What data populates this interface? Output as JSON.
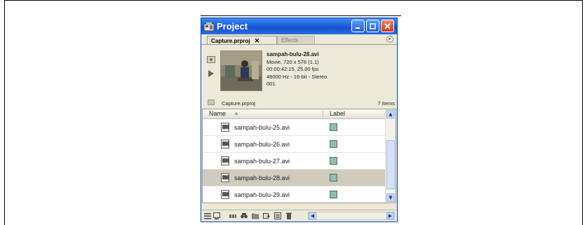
{
  "window": {
    "title": "Project",
    "icon": "premiere-app-icon",
    "controls": [
      "minimize-icon",
      "maximize-icon",
      "close-icon"
    ]
  },
  "tabs": [
    {
      "label": "Capture.prproj",
      "active": true,
      "close": "✕"
    },
    {
      "label": "Effects",
      "active": false
    }
  ],
  "panel_menu": "▸",
  "preview": {
    "clip_name": "sampah-bulu-28.avi",
    "lines": [
      "Movie, 720 x 576 (1.1)",
      "00:00:42:15, 25.00 fps",
      "48000 Hz - 16-bit - Stereo",
      "001"
    ]
  },
  "project_bar": {
    "project_name": "Capture.prproj",
    "item_count": "7 Items"
  },
  "list": {
    "columns": {
      "name": "Name",
      "label": "Label"
    },
    "sort_arrow": "▲",
    "rows": [
      {
        "name": "sampah-bulu-25.avi",
        "selected": false
      },
      {
        "name": "sampah-bulu-26.avi",
        "selected": false
      },
      {
        "name": "sampah-bulu-27.avi",
        "selected": false
      },
      {
        "name": "sampah-bulu-28.avi",
        "selected": true
      },
      {
        "name": "sampah-bulu-29.avi",
        "selected": false
      }
    ],
    "label_color": "#8fbfaf"
  },
  "bottom_tools": [
    "list-view-icon",
    "icon-view-icon",
    "automate-to-sequence-icon",
    "find-icon",
    "new-bin-icon",
    "new-item-icon",
    "clear-icon"
  ],
  "colors": {
    "titlebar": "#1f5fdb",
    "panel_bg": "#ece9d8",
    "selected_row": "#cfcbbd"
  }
}
